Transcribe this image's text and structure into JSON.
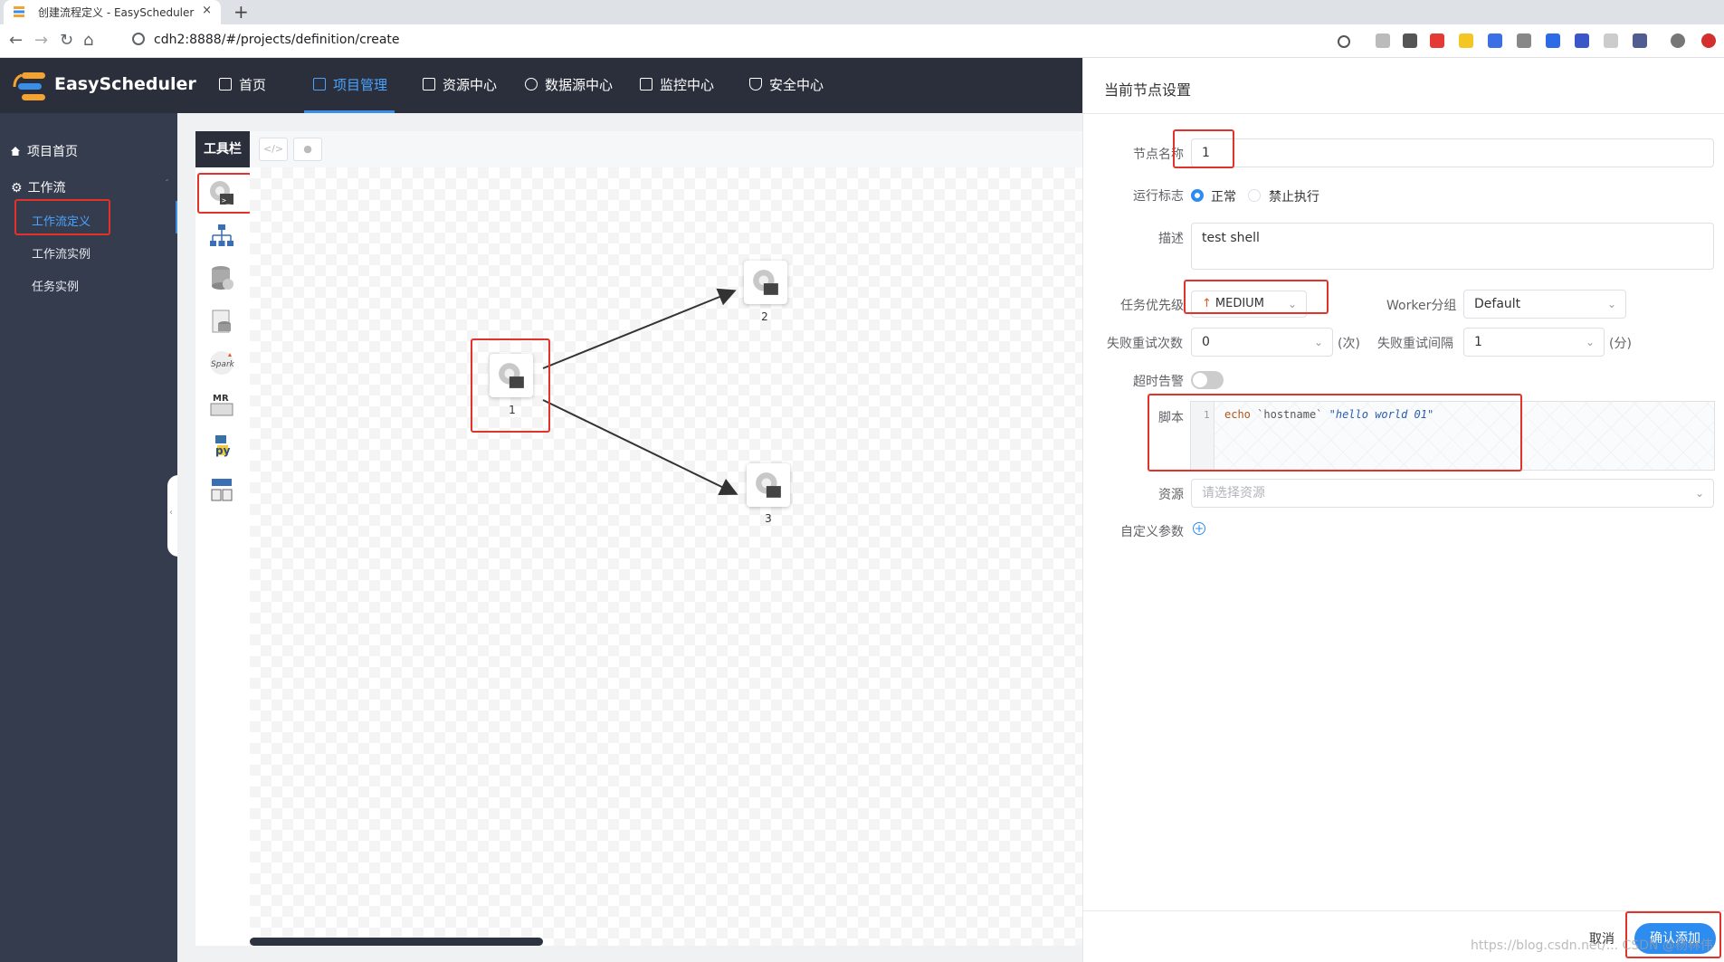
{
  "browser": {
    "tab_title": "创建流程定义 - EasyScheduler",
    "tab_close": "×",
    "new_tab": "+",
    "url": "cdh2:8888/#/projects/definition/create"
  },
  "header": {
    "brand": "EasyScheduler",
    "nav": [
      "首页",
      "项目管理",
      "资源中心",
      "数据源中心",
      "监控中心",
      "安全中心"
    ]
  },
  "sidebar": {
    "project_home": "项目首页",
    "workflow_group": "工作流",
    "items": [
      "工作流定义",
      "工作流实例",
      "任务实例"
    ]
  },
  "canvas": {
    "toolbar_title": "工具栏",
    "nodes": [
      {
        "label": "1"
      },
      {
        "label": "2"
      },
      {
        "label": "3"
      }
    ]
  },
  "drawer": {
    "title": "当前节点设置",
    "node_name_label": "节点名称",
    "node_name_value": "1",
    "run_flag_label": "运行标志",
    "run_flag_options": [
      "正常",
      "禁止执行"
    ],
    "desc_label": "描述",
    "desc_value": "test shell",
    "priority_label": "任务优先级",
    "priority_value": "MEDIUM",
    "worker_label": "Worker分组",
    "worker_value": "Default",
    "retry_times_label": "失败重试次数",
    "retry_times_value": "0",
    "retry_times_unit": "(次)",
    "retry_interval_label": "失败重试间隔",
    "retry_interval_value": "1",
    "retry_interval_unit": "(分)",
    "timeout_label": "超时告警",
    "script_label": "脚本",
    "script_line_no": "1",
    "script_kw": "echo",
    "script_bt": "`hostname`",
    "script_str": "\"hello world 01\"",
    "resource_label": "资源",
    "resource_placeholder": "请选择资源",
    "custom_params_label": "自定义参数",
    "cancel": "取消",
    "confirm": "确认添加"
  },
  "watermark": "https://blog.csdn.net/... CSDN @杨林伟",
  "colors": {
    "accent": "#2d8cf0",
    "header": "#2a2f3b",
    "sidebar": "#343c4e",
    "highlight": "#e2332a"
  }
}
